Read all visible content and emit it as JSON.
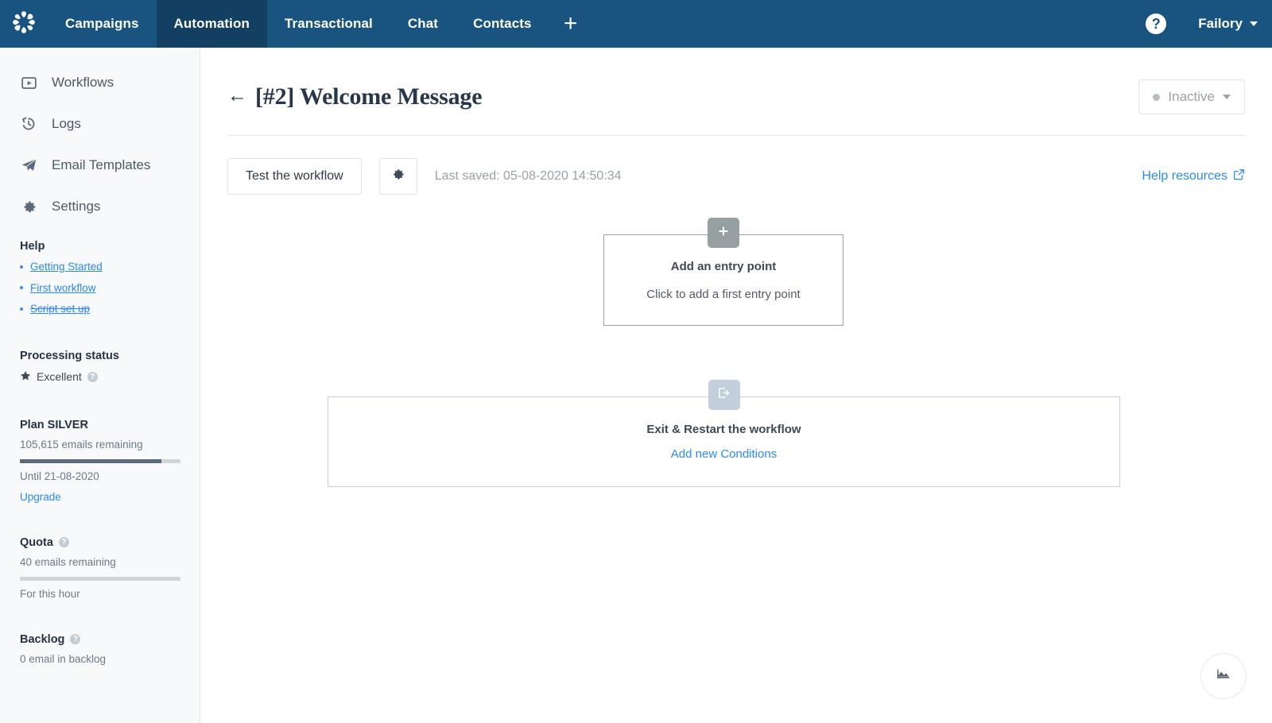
{
  "topnav": {
    "logo_icon": "pinwheel-logo-icon",
    "items": [
      {
        "label": "Campaigns",
        "active": false
      },
      {
        "label": "Automation",
        "active": true
      },
      {
        "label": "Transactional",
        "active": false
      },
      {
        "label": "Chat",
        "active": false
      },
      {
        "label": "Contacts",
        "active": false
      }
    ],
    "add_label": "+",
    "help_label": "?",
    "account_label": "Failory",
    "background_color": "#19537f",
    "active_background_color": "#123f62"
  },
  "sidebar": {
    "nav": [
      {
        "label": "Workflows",
        "icon": "play-box-icon"
      },
      {
        "label": "Logs",
        "icon": "history-icon"
      },
      {
        "label": "Email Templates",
        "icon": "paper-plane-icon"
      },
      {
        "label": "Settings",
        "icon": "gear-icon"
      }
    ],
    "help": {
      "heading": "Help",
      "links": [
        {
          "label": "Getting Started",
          "completed": false
        },
        {
          "label": "First workflow",
          "completed": false
        },
        {
          "label": "Script set up",
          "completed": true
        }
      ]
    },
    "processing": {
      "heading": "Processing status",
      "value": "Excellent",
      "icon": "star-icon",
      "tooltip_label": "?"
    },
    "plan": {
      "heading": "Plan SILVER",
      "remaining": "105,615 emails remaining",
      "progress_percent": 88,
      "until": "Until 21-08-2020",
      "upgrade_label": "Upgrade"
    },
    "quota": {
      "heading": "Quota",
      "tooltip_label": "?",
      "remaining": "40 emails remaining",
      "progress_percent": 0,
      "period": "For this hour"
    },
    "backlog": {
      "heading": "Backlog",
      "tooltip_label": "?",
      "value": "0 email in backlog"
    }
  },
  "main": {
    "back_arrow": "←",
    "title": "[#2] Welcome Message",
    "status": {
      "label": "Inactive",
      "dot_color": "#b6bcc3"
    },
    "toolbar": {
      "test_label": "Test the workflow",
      "settings_icon": "gear-icon",
      "last_saved": "Last saved: 05-08-2020 14:50:34",
      "help_resources_label": "Help resources",
      "help_resources_icon": "external-link-icon"
    },
    "entry_node": {
      "tab_icon": "plus-icon",
      "title": "Add an entry point",
      "subtitle": "Click to add a first entry point"
    },
    "exit_node": {
      "tab_icon": "exit-icon",
      "title": "Exit & Restart the workflow",
      "action_label": "Add new Conditions"
    },
    "stats_fab_icon": "area-chart-icon"
  }
}
